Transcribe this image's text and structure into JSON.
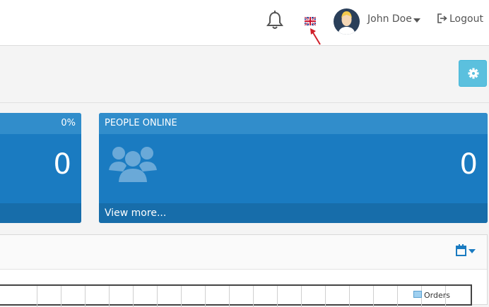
{
  "header": {
    "user_name": "John Doe",
    "logout_label": "Logout"
  },
  "cards": [
    {
      "percent": "0%",
      "value": "0"
    },
    {
      "title": "PEOPLE ONLINE",
      "value": "0",
      "footer": "View more..."
    }
  ],
  "chart": {
    "legend_label": "Orders"
  },
  "colors": {
    "card_blue": "#1a7bc1",
    "settings_button": "#5bc0de",
    "annotation_arrow": "#d0202a"
  },
  "icons": [
    "bell-icon",
    "uk-flag-icon",
    "user-avatar",
    "caret-down-icon",
    "logout-icon",
    "gear-icon",
    "people-icon",
    "calendar-icon"
  ]
}
